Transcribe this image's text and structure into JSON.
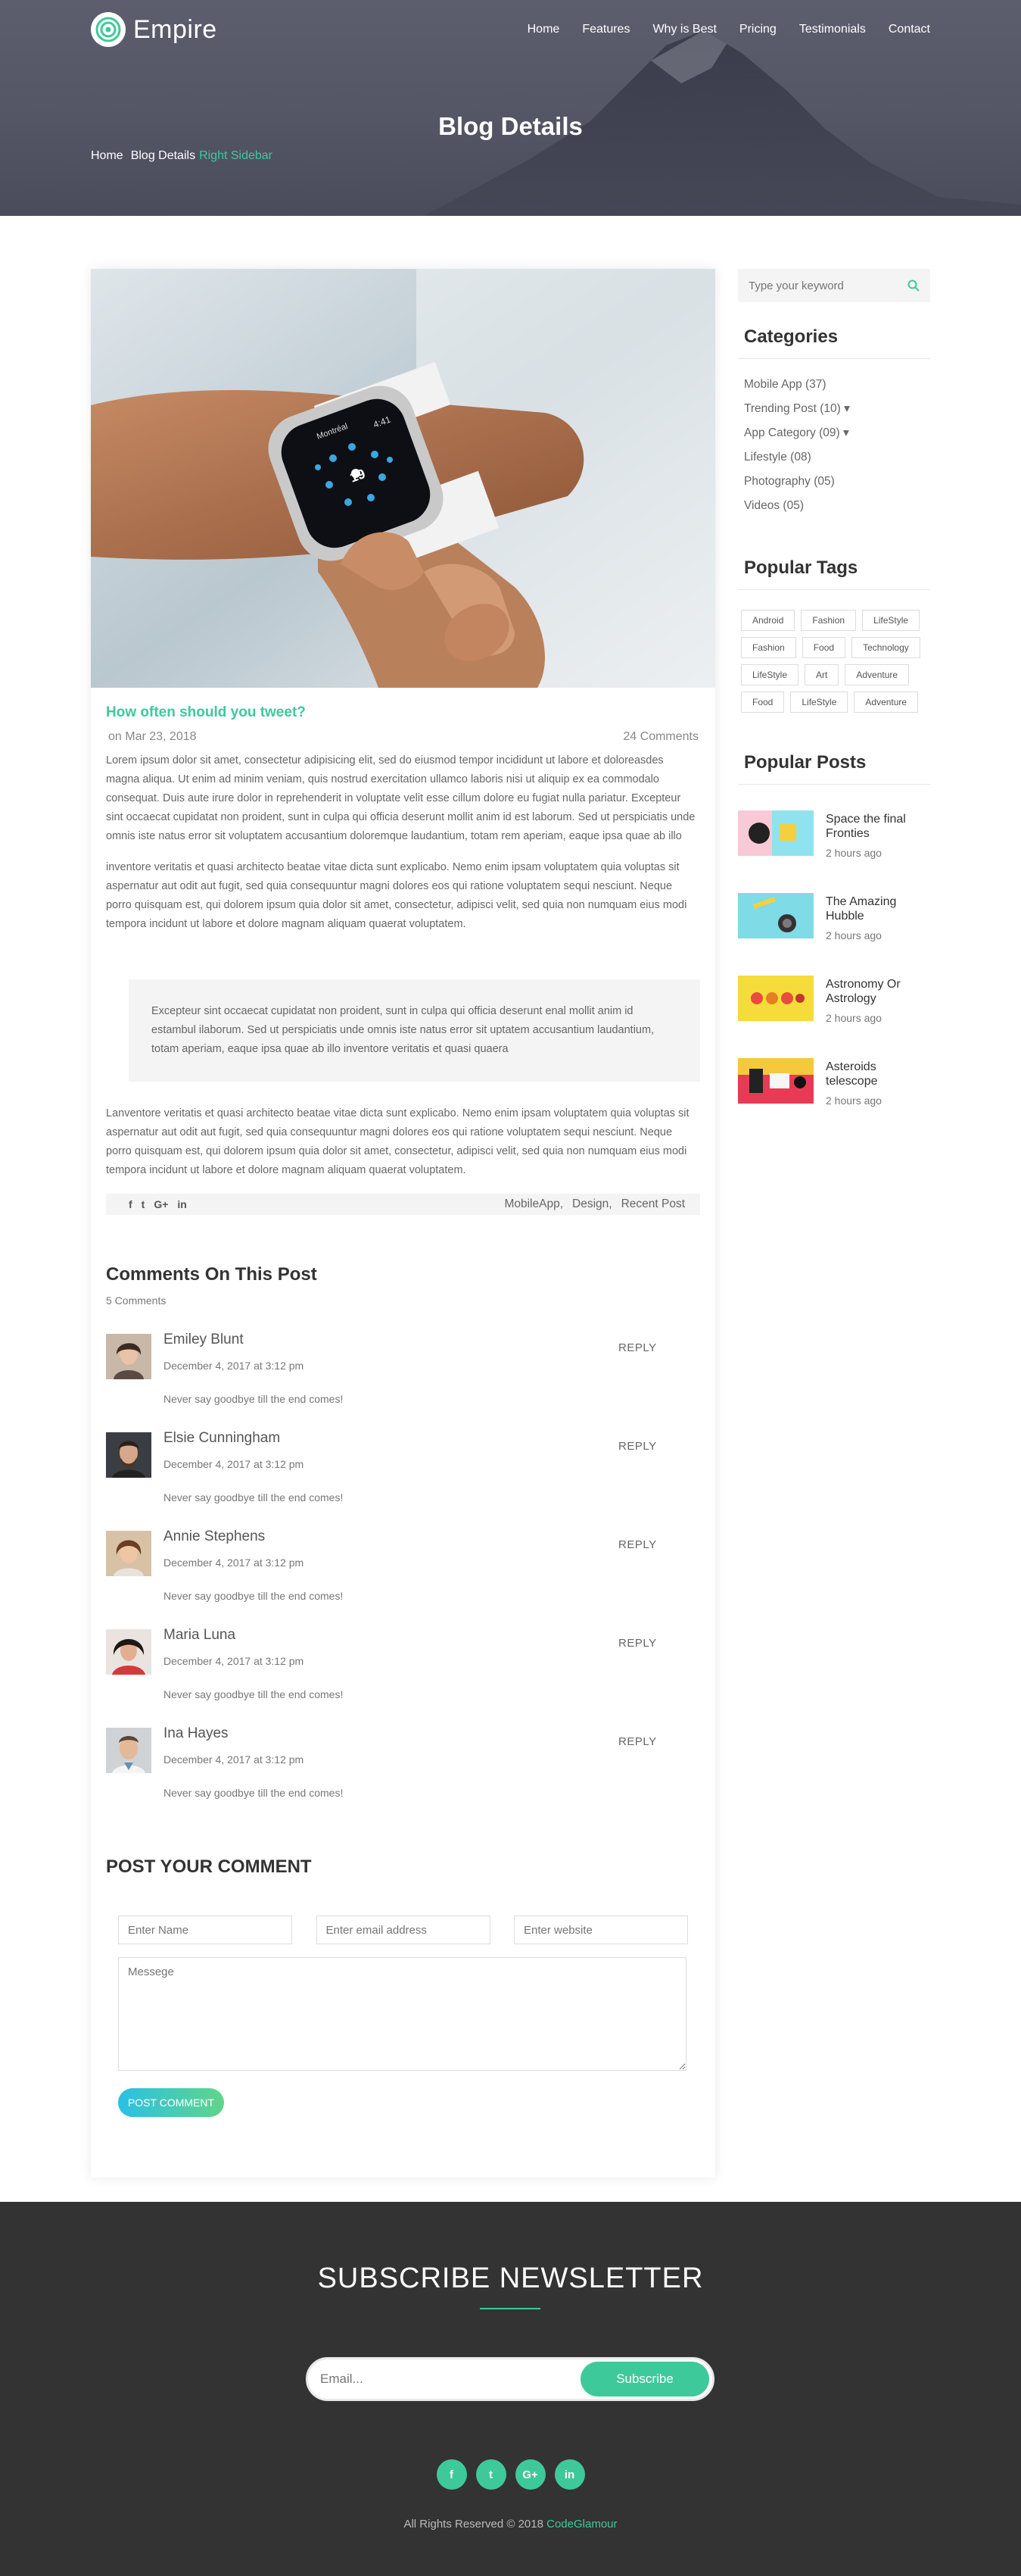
{
  "header": {
    "brand": "Empire",
    "menu": [
      "Home",
      "Features",
      "Why is Best",
      "Pricing",
      "Testimonials",
      "Contact"
    ],
    "page_title": "Blog Details",
    "breadcrumb": {
      "home": "Home",
      "parent": "Blog Details",
      "current": "Right Sidebar"
    }
  },
  "post": {
    "title": "How often should you tweet?",
    "date": "on Mar 23, 2018",
    "comment_count": "24 Comments",
    "watch_time": "4:41",
    "watch_city": "Montréal",
    "watch_day": "19",
    "para1": "Lorem ipsum dolor sit amet, consectetur adipisicing elit, sed do eiusmod tempor incididunt ut labore et doloreasdes magna aliqua. Ut enim ad minim veniam, quis nostrud exercitation ullamco laboris nisi ut aliquip ex ea commodalo consequat. Duis aute irure dolor in reprehenderit in voluptate velit esse cillum dolore eu fugiat nulla pariatur. Excepteur sint occaecat cupidatat non proident, sunt in culpa qui officia deserunt mollit anim id est laborum. Sed ut perspiciatis unde omnis iste natus error sit voluptatem accusantium doloremque laudantium, totam rem aperiam, eaque ipsa quae ab illo",
    "para2": "inventore veritatis et quasi architecto beatae vitae dicta sunt explicabo. Nemo enim ipsam voluptatem quia voluptas sit aspernatur aut odit aut fugit, sed quia consequuntur magni dolores eos qui ratione voluptatem sequi nesciunt. Neque porro quisquam est, qui dolorem ipsum quia dolor sit amet, consectetur, adipisci velit, sed quia non numquam eius modi tempora incidunt ut labore et dolore magnam aliquam quaerat voluptatem.",
    "quote": "Excepteur sint occaecat cupidatat non proident, sunt in culpa qui officia deserunt enal mollit anim id estambul ilaborum. Sed ut perspiciatis unde omnis iste natus error sit uptatem accusantium laudantium, totam aperiam, eaque ipsa quae ab illo inventore veritatis et quasi quaera",
    "para3": "Lanventore veritatis et quasi architecto beatae vitae dicta sunt explicabo. Nemo enim ipsam voluptatem quia voluptas sit aspernatur aut odit aut fugit, sed quia consequuntur magni dolores eos qui ratione voluptatem sequi nesciunt. Neque porro quisquam est, qui dolorem ipsum quia dolor sit amet, consectetur, adipisci velit, sed quia non numquam eius modi tempora incidunt ut labore et dolore magnam aliquam quaerat voluptatem.",
    "share_icons": [
      "f",
      "t",
      "G+",
      "in"
    ],
    "tags": [
      "MobileApp,",
      "Design,",
      "Recent Post"
    ]
  },
  "comments": {
    "title": "Comments On This Post",
    "count": "5 Comments",
    "reply_label": "REPLY",
    "items": [
      {
        "name": "Emiley Blunt",
        "date": "December 4, 2017 at 3:12 pm",
        "text": "Never say goodbye till the end comes!"
      },
      {
        "name": "Elsie Cunningham",
        "date": "December 4, 2017 at 3:12 pm",
        "text": "Never say goodbye till the end comes!"
      },
      {
        "name": "Annie Stephens",
        "date": "December 4, 2017 at 3:12 pm",
        "text": "Never say goodbye till the end comes!"
      },
      {
        "name": "Maria Luna",
        "date": "December 4, 2017 at 3:12 pm",
        "text": "Never say goodbye till the end comes!"
      },
      {
        "name": "Ina Hayes",
        "date": "December 4, 2017 at 3:12 pm",
        "text": "Never say goodbye till the end comes!"
      }
    ]
  },
  "comment_form": {
    "title": "POST YOUR COMMENT",
    "name_placeholder": "Enter Name",
    "email_placeholder": "Enter email address",
    "website_placeholder": "Enter website",
    "message_placeholder": "Messege",
    "submit_label": "POST COMMENT"
  },
  "sidebar": {
    "search_placeholder": "Type your keyword",
    "categories_title": "Categories",
    "categories": [
      "Mobile App (37)",
      "Trending Post (10) ▾",
      "App Category (09) ▾",
      "Lifestyle (08)",
      "Photography (05)",
      "Videos (05)"
    ],
    "tags_title": "Popular Tags",
    "tags": [
      "Android",
      "Fashion",
      "LifeStyle",
      "Fashion",
      "Food",
      "Technology",
      "LifeStyle",
      "Art",
      "Adventure",
      "Food",
      "LifeStyle",
      "Adventure"
    ],
    "posts_title": "Popular Posts",
    "posts": [
      {
        "title": "Space the final Fronties",
        "time": "2 hours ago",
        "color1": "#f9c9d8",
        "color2": "#8fe3ef"
      },
      {
        "title": "The Amazing Hubble",
        "time": "2 hours ago",
        "color1": "#7fdbe6",
        "color2": "#a5ecf2"
      },
      {
        "title": "Astronomy Or Astrology",
        "time": "2 hours ago",
        "color1": "#f5dc3a",
        "color2": "#f7e35b"
      },
      {
        "title": "Asteroids telescope",
        "time": "2 hours ago",
        "color1": "#f4c93c",
        "color2": "#e93a55"
      }
    ]
  },
  "footer": {
    "newsletter_title": "SUBSCRIBE NEWSLETTER",
    "email_placeholder": "Email...",
    "subscribe_label": "Subscribe",
    "social": [
      "f",
      "t",
      "G+",
      "in"
    ],
    "copyright": "All Rights Reserved © 2018",
    "copyright_brand": "CodeGlamour"
  },
  "colors": {
    "accent": "#3ec99a",
    "footer_bg": "#333333",
    "hero_bg": "#545565"
  }
}
